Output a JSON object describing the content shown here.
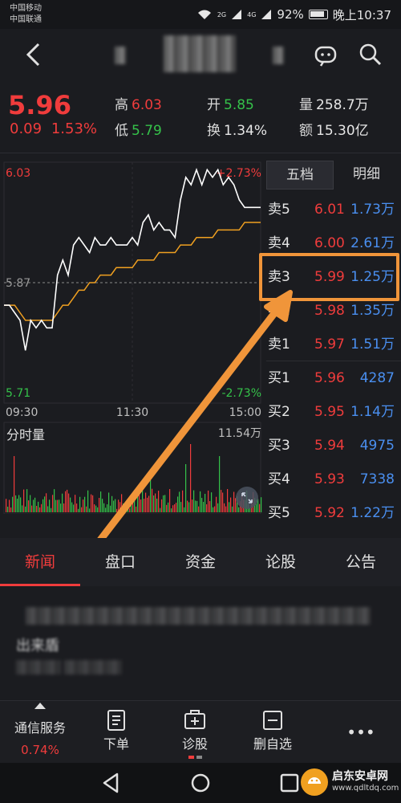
{
  "status": {
    "carrier1": "中国移动",
    "carrier2": "中国联通",
    "net1": "2G",
    "net2": "4G",
    "battery": "92%",
    "time": "晚上10:37"
  },
  "quote": {
    "price": "5.96",
    "change": "0.09",
    "change_pct": "1.53%",
    "high_label": "高",
    "high": "6.03",
    "low_label": "低",
    "low": "5.79",
    "open_label": "开",
    "open": "5.85",
    "turnover_label": "换",
    "turnover": "1.34%",
    "volume_label": "量",
    "volume": "258.7万",
    "amount_label": "额",
    "amount": "15.30亿"
  },
  "chart": {
    "y_top": "6.03",
    "y_mid": "5.87",
    "y_bottom": "5.71",
    "pct_top": "+2.73%",
    "pct_bottom": "-2.73%",
    "x_labels": [
      "09:30",
      "11:30",
      "15:00"
    ],
    "volume_title": "分时量",
    "volume_max": "11.54万",
    "colors": {
      "price_line": "#ffffff",
      "avg_line": "#f0a020",
      "up": "#f03c3c",
      "down": "#35c24a"
    }
  },
  "chart_data": {
    "type": "line",
    "x": [
      0,
      5,
      10,
      15,
      20,
      25,
      30,
      35,
      40,
      45,
      50,
      55,
      60,
      65,
      70,
      75,
      80,
      85,
      90,
      95,
      100,
      105,
      110,
      115,
      120,
      125,
      130,
      135,
      140,
      145,
      150,
      155,
      160,
      165,
      170,
      175,
      180,
      185,
      190,
      195,
      200,
      205,
      210,
      215,
      220,
      225,
      230,
      235,
      240
    ],
    "series": [
      {
        "values": [
          5.84,
          5.84,
          5.83,
          5.82,
          5.78,
          5.82,
          5.81,
          5.82,
          5.81,
          5.81,
          5.88,
          5.9,
          5.88,
          5.92,
          5.93,
          5.92,
          5.91,
          5.93,
          5.92,
          5.92,
          5.93,
          5.92,
          5.92,
          5.92,
          5.93,
          5.92,
          5.95,
          5.96,
          5.94,
          5.95,
          5.94,
          5.94,
          5.93,
          5.98,
          6.01,
          6.0,
          6.02,
          6.0,
          6.02,
          6.01,
          6.02,
          6.0,
          6.01,
          6.0,
          5.98,
          5.97,
          5.97,
          5.97,
          5.97
        ]
      },
      {
        "values": [
          5.84,
          5.84,
          5.84,
          5.83,
          5.82,
          5.82,
          5.82,
          5.82,
          5.82,
          5.82,
          5.83,
          5.84,
          5.84,
          5.85,
          5.86,
          5.86,
          5.87,
          5.87,
          5.88,
          5.88,
          5.88,
          5.89,
          5.89,
          5.89,
          5.89,
          5.9,
          5.9,
          5.9,
          5.9,
          5.91,
          5.91,
          5.91,
          5.91,
          5.92,
          5.92,
          5.92,
          5.93,
          5.93,
          5.93,
          5.93,
          5.94,
          5.94,
          5.94,
          5.94,
          5.94,
          5.95,
          5.95,
          5.95,
          5.95
        ]
      }
    ],
    "ylim": [
      5.71,
      6.03
    ],
    "title": "",
    "xlabel": "",
    "ylabel": ""
  },
  "book": {
    "tabs": [
      "五档",
      "明细"
    ],
    "asks": [
      {
        "side": "卖5",
        "price": "6.01",
        "vol": "1.73万"
      },
      {
        "side": "卖4",
        "price": "6.00",
        "vol": "2.61万"
      },
      {
        "side": "卖3",
        "price": "5.99",
        "vol": "1.25万"
      },
      {
        "side": "卖2",
        "price": "5.98",
        "vol": "1.35万"
      },
      {
        "side": "卖1",
        "price": "5.97",
        "vol": "1.51万"
      }
    ],
    "bids": [
      {
        "side": "买1",
        "price": "5.96",
        "vol": "4287"
      },
      {
        "side": "买2",
        "price": "5.95",
        "vol": "1.14万"
      },
      {
        "side": "买3",
        "price": "5.94",
        "vol": "4975"
      },
      {
        "side": "买4",
        "price": "5.93",
        "vol": "7338"
      },
      {
        "side": "买5",
        "price": "5.92",
        "vol": "1.22万"
      }
    ]
  },
  "tabs": [
    "新闻",
    "盘口",
    "资金",
    "论股",
    "公告"
  ],
  "news": {
    "line2": "出来盾"
  },
  "bottom": {
    "sector_name": "通信服务",
    "sector_pct": "0.74%",
    "order": "下单",
    "diagnose": "诊股",
    "remove_watch": "删自选",
    "more": "•••"
  },
  "watermark": {
    "name": "启东安卓网",
    "url": "www.qdltdq.com"
  }
}
